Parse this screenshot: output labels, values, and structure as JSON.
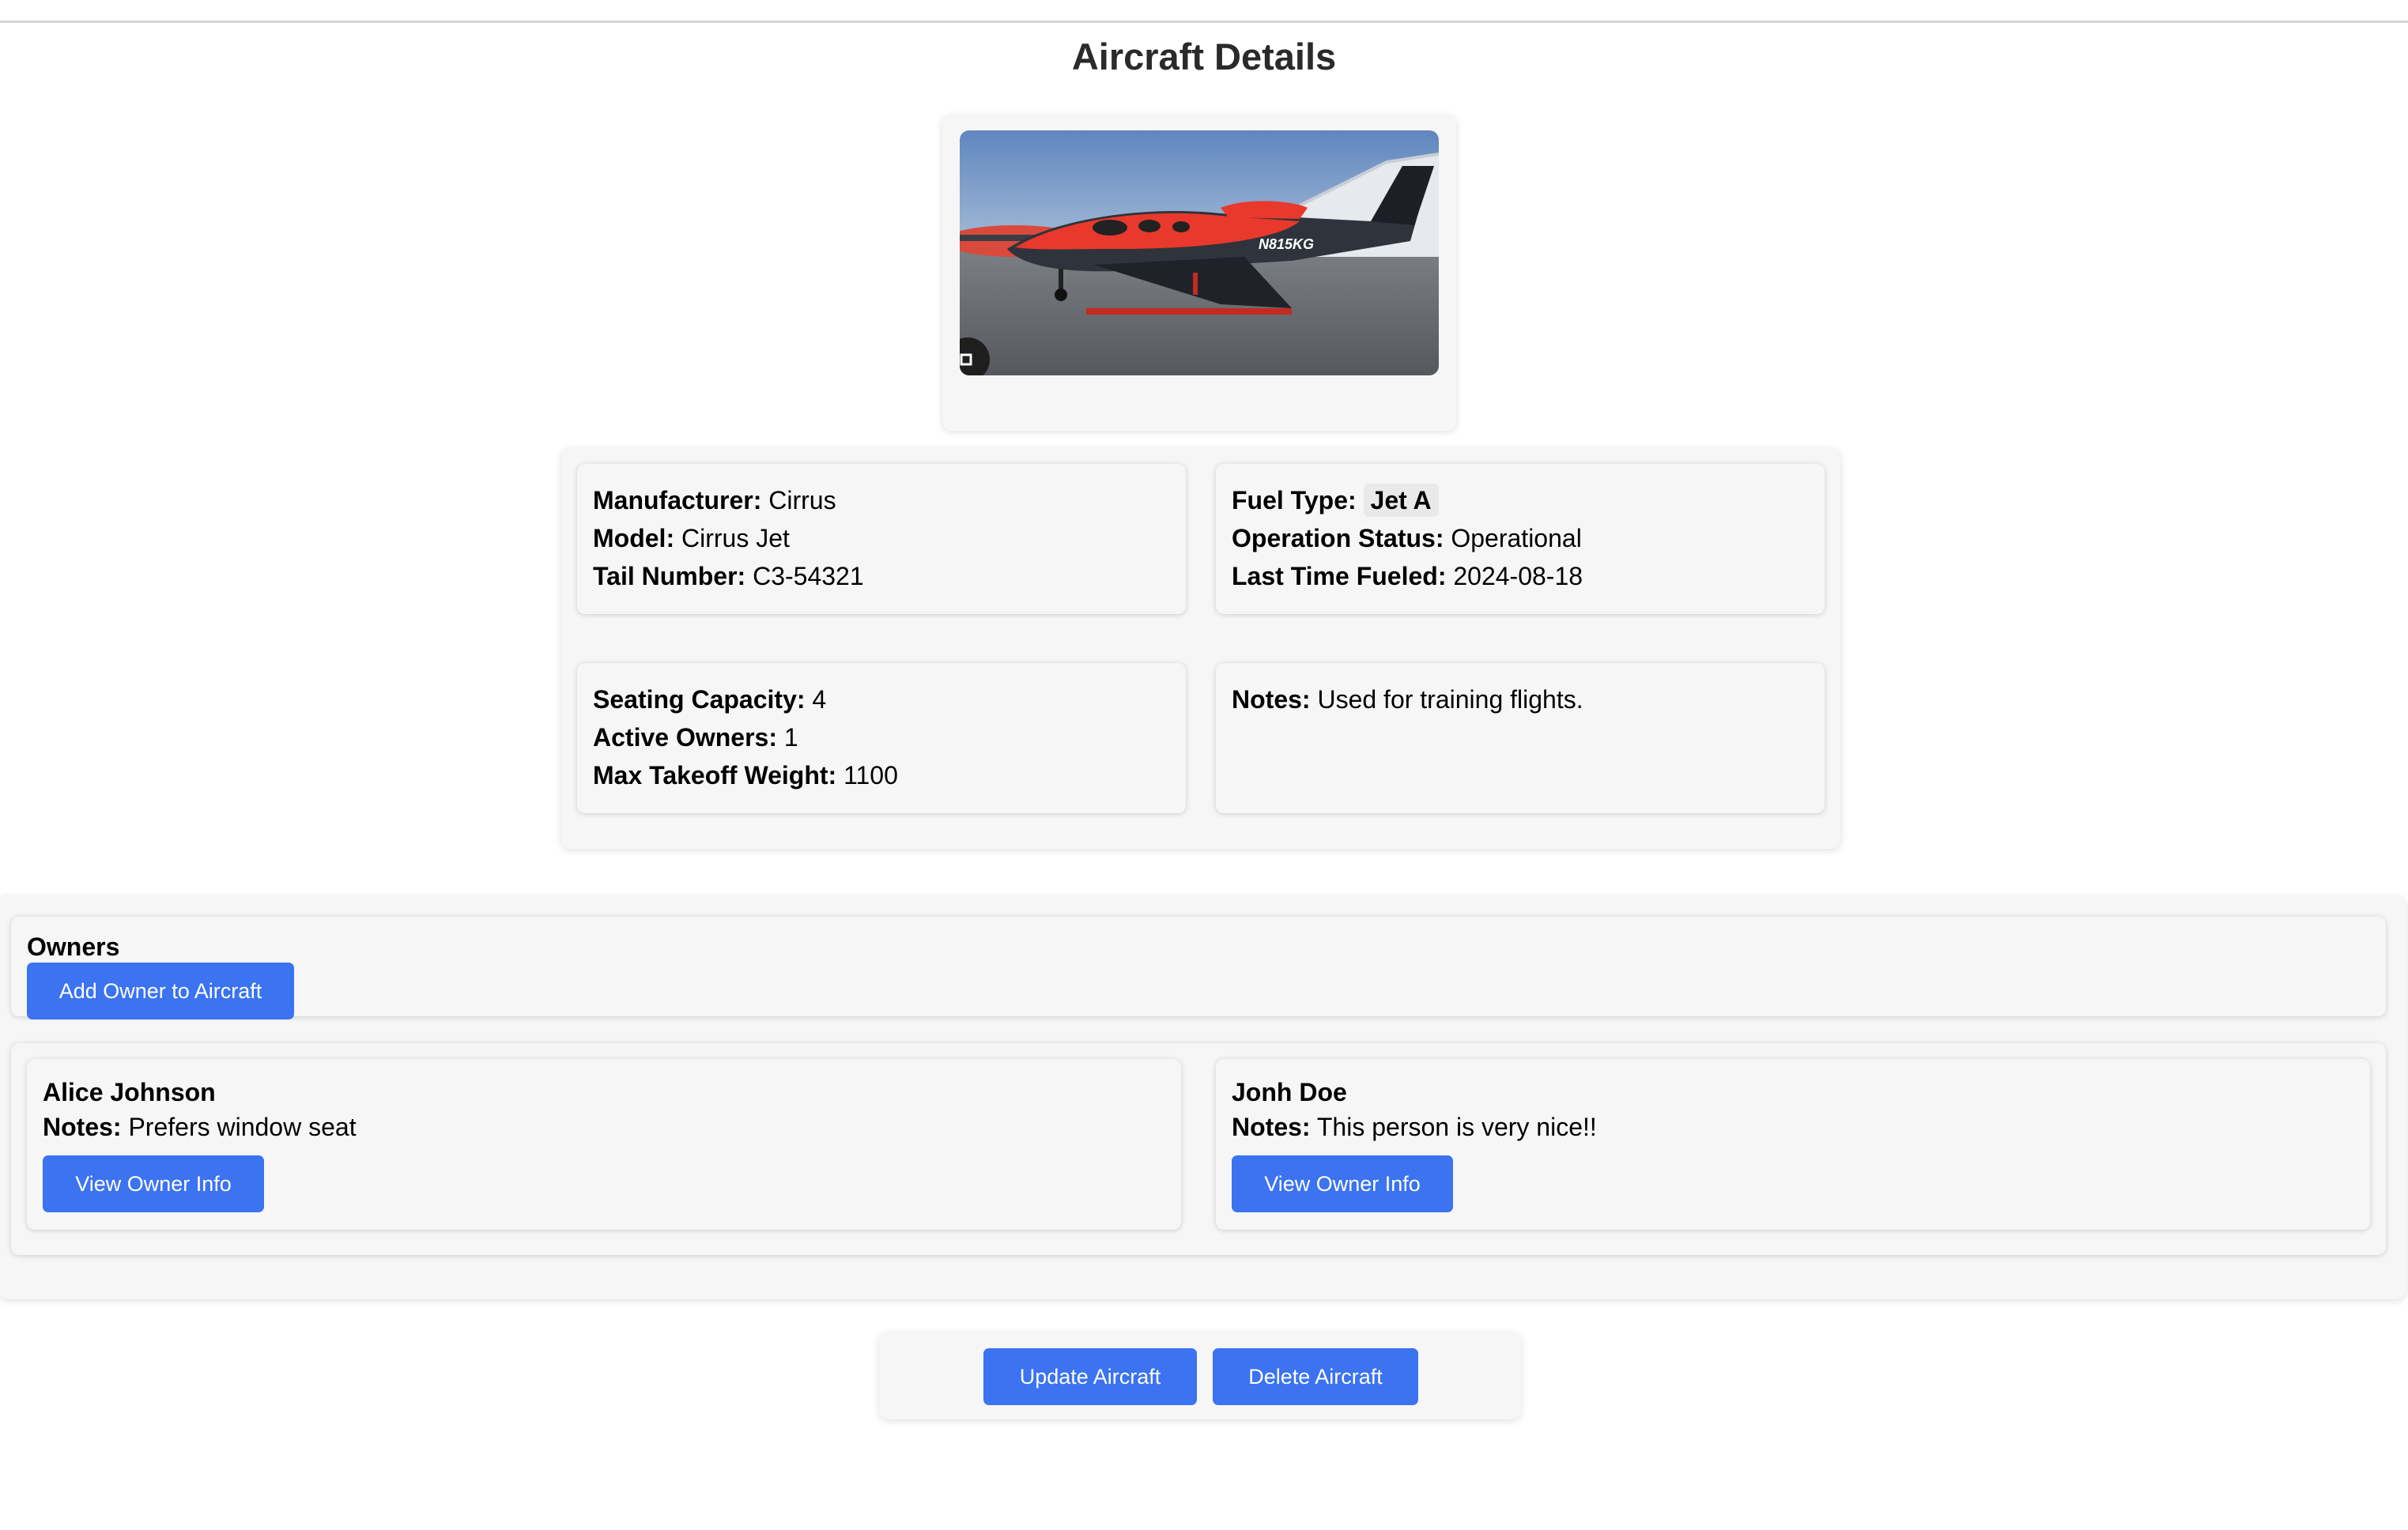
{
  "page": {
    "title": "Aircraft Details"
  },
  "aircraft": {
    "image": {
      "registration_text": "N815KG",
      "fuselage_color": "#e8392c"
    },
    "specs": {
      "manufacturer_label": "Manufacturer:",
      "manufacturer": "Cirrus",
      "model_label": "Model:",
      "model": "Cirrus Jet",
      "tail_label": "Tail Number:",
      "tail_number": "C3-54321"
    },
    "fuel": {
      "fuel_type_label": "Fuel Type:",
      "fuel_type": "Jet A",
      "status_label": "Operation Status:",
      "status": "Operational",
      "last_fueled_label": "Last Time Fueled:",
      "last_fueled": "2024-08-18"
    },
    "capacity": {
      "seating_label": "Seating Capacity:",
      "seating": "4",
      "owners_label": "Active Owners:",
      "owners": "1",
      "mtow_label": "Max Takeoff Weight:",
      "mtow": "1100"
    },
    "notes": {
      "label": "Notes:",
      "value": "Used for training flights."
    }
  },
  "owners": {
    "title": "Owners",
    "add_button": "Add Owner to Aircraft",
    "list": [
      {
        "name": "Alice Johnson",
        "notes_label": "Notes:",
        "notes": "Prefers window seat",
        "button": "View Owner Info"
      },
      {
        "name": "Jonh Doe",
        "notes_label": "Notes:",
        "notes": "This person is very nice!!",
        "button": "View Owner Info"
      }
    ]
  },
  "actions": {
    "update": "Update Aircraft",
    "delete": "Delete Aircraft"
  },
  "colors": {
    "primary_button": "#3b73f0",
    "card_bg": "#f6f6f6"
  }
}
